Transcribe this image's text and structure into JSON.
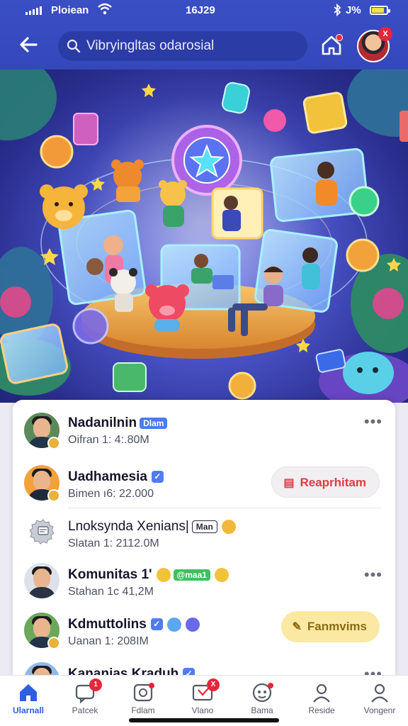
{
  "status_bar": {
    "carrier": "Ploiean",
    "time": "16J29",
    "battery": "J%",
    "battery_level": 0.85
  },
  "header": {
    "search_text": "Vibryingltas odarosial"
  },
  "list": [
    {
      "name": "Nadanilnin",
      "tag": "Dlam",
      "sub": "Oifran 1: 4:.80M"
    },
    {
      "name": "Uadhamesia",
      "sub": "Bimen ı6: 22.000",
      "action": "Reaprhitam"
    },
    {
      "name": "Lnoksynda Xenians|",
      "tag": "Man",
      "sub": "Slatan 1: 2112.0M"
    },
    {
      "name": "Komunitas 1'",
      "tag": "@maa1",
      "sub": "Stahan 1c 41,2M"
    },
    {
      "name": "Kdmuttolins",
      "sub": "Uanan 1: 208IM",
      "action": "Fanmvims"
    },
    {
      "name": "Kananias Kraduh"
    }
  ],
  "bottom_nav": [
    {
      "label": "Ularnall",
      "icon": "home-icon",
      "active": true
    },
    {
      "label": "Patcek",
      "icon": "chat-icon",
      "badge": "1"
    },
    {
      "label": "Fdlam",
      "icon": "explore-icon"
    },
    {
      "label": "Vlano",
      "icon": "video-icon",
      "badge": "X"
    },
    {
      "label": "Bama",
      "icon": "notifications-icon"
    },
    {
      "label": "Reside",
      "icon": "profile-icon"
    },
    {
      "label": "Vongenr",
      "icon": "account-icon"
    }
  ]
}
